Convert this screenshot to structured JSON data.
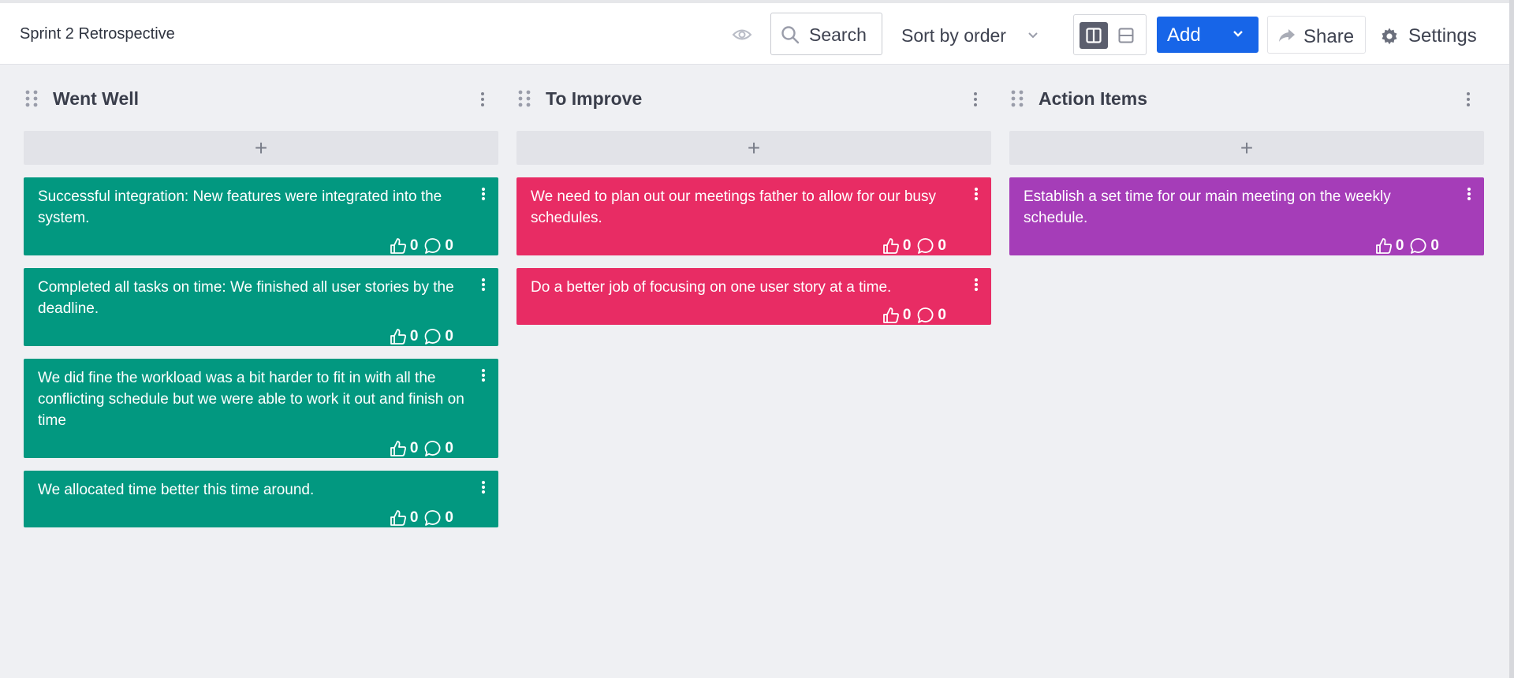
{
  "board": {
    "title": "Sprint 2 Retrospective"
  },
  "toolbar": {
    "search_label": "Search",
    "sort_label": "Sort by order",
    "add_label": "Add",
    "share_label": "Share",
    "settings_label": "Settings"
  },
  "columns": [
    {
      "title": "Went Well",
      "color": "#029880",
      "cards": [
        {
          "text": "Successful integration: New features were integrated into the system.",
          "likes": "0",
          "comments": "0"
        },
        {
          "text": "Completed all tasks on time: We finished all user stories by the deadline.",
          "likes": "0",
          "comments": "0"
        },
        {
          "text": "We did fine the workload was a bit harder to fit in with all the conflicting schedule but we were able to work it out and finish on time",
          "likes": "0",
          "comments": "0"
        },
        {
          "text": "We allocated time better this time around.",
          "likes": "0",
          "comments": "0"
        }
      ]
    },
    {
      "title": "To Improve",
      "color": "#e82c64",
      "cards": [
        {
          "text": "We need to plan out our meetings father to allow for our busy schedules.",
          "likes": "0",
          "comments": "0"
        },
        {
          "text": "Do a better job of focusing on one user story at a time.",
          "likes": "0",
          "comments": "0"
        }
      ]
    },
    {
      "title": "Action Items",
      "color": "#a53db8",
      "cards": [
        {
          "text": "Establish a set time for our main meeting on the weekly schedule.",
          "likes": "0",
          "comments": "0"
        }
      ]
    }
  ]
}
